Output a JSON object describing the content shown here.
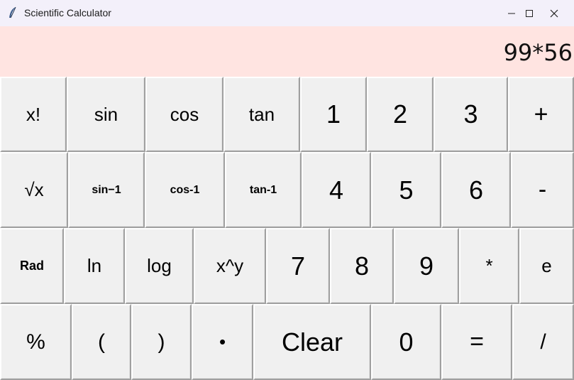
{
  "window": {
    "title": "Scientific Calculator",
    "icon": "feather-icon",
    "controls": [
      "minimize-icon",
      "maximize-icon",
      "close-icon"
    ]
  },
  "display": {
    "value": "99*56",
    "background": "#ffe4e1"
  },
  "keys": {
    "row1": [
      "x!",
      "sin",
      "cos",
      "tan",
      "1",
      "2",
      "3",
      "+"
    ],
    "row2": [
      "√x",
      "sin−1",
      "cos-1",
      "tan-1",
      "4",
      "5",
      "6",
      "-"
    ],
    "row3": [
      "Rad",
      "ln",
      "log",
      "x^y",
      "7",
      "8",
      "9",
      "*",
      "e"
    ],
    "row4": [
      "%",
      "(",
      ")",
      "•",
      "Clear",
      "0",
      "=",
      "/"
    ]
  }
}
